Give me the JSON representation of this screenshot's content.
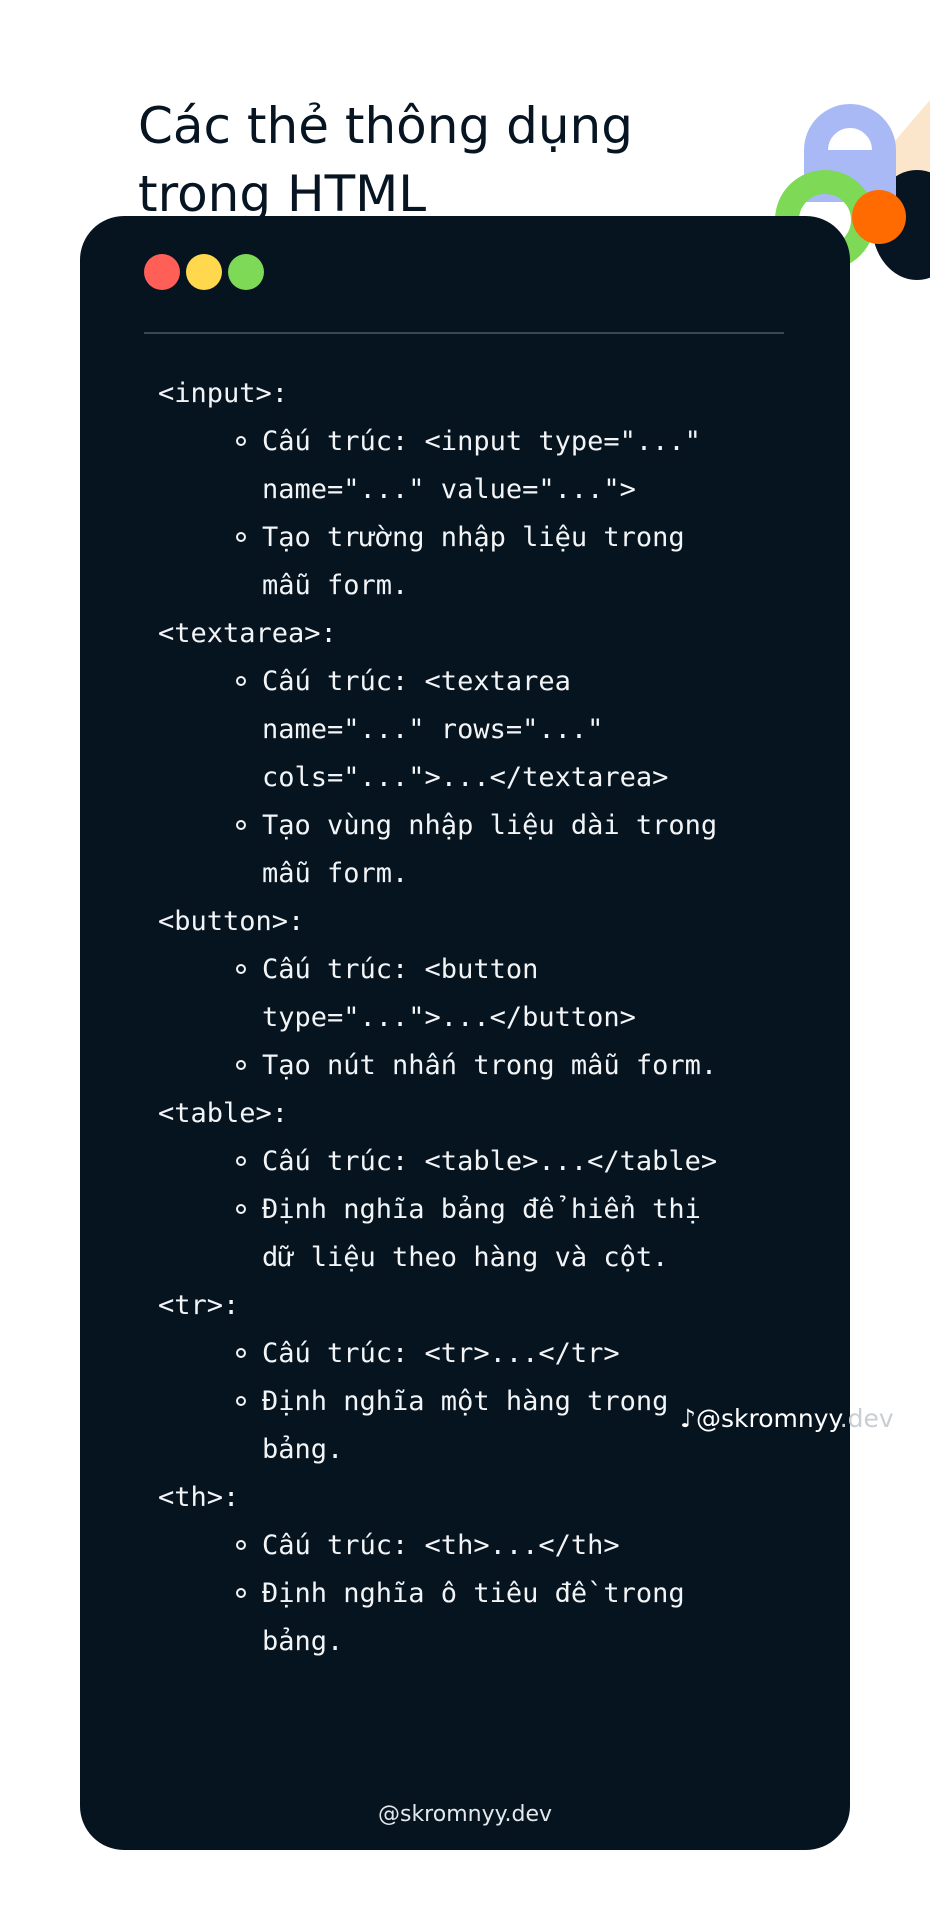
{
  "title": {
    "line1": "Các thẻ thông dụng",
    "line2": "trong HTML"
  },
  "window_dots": {
    "red": "#ff5f57",
    "yellow": "#ffd84d",
    "green": "#7ed957"
  },
  "sections": [
    {
      "tag": "<input>:",
      "bullets": [
        [
          "Cấu trúc: <input type=\"...\"",
          "name=\"...\" value=\"...\">"
        ],
        [
          "Tạo trường nhập liệu trong",
          "mẫu form."
        ]
      ]
    },
    {
      "tag": "<textarea>:",
      "bullets": [
        [
          "Cấu trúc: <textarea",
          "name=\"...\" rows=\"...\"",
          "cols=\"...\">...</textarea>"
        ],
        [
          "Tạo vùng nhập liệu dài trong",
          "mẫu form."
        ]
      ]
    },
    {
      "tag": "<button>:",
      "bullets": [
        [
          "Cấu trúc: <button",
          "type=\"...\">...</button>"
        ],
        [
          "Tạo nút nhấn trong mẫu form."
        ]
      ]
    },
    {
      "tag": "<table>:",
      "bullets": [
        [
          "Cấu trúc: <table>...</table>"
        ],
        [
          "Định nghĩa bảng để hiển thị",
          "dữ liệu theo hàng và cột."
        ]
      ]
    },
    {
      "tag": "<tr>:",
      "bullets": [
        [
          "Cấu trúc: <tr>...</tr>"
        ],
        [
          "Định nghĩa một hàng trong",
          "bảng."
        ]
      ]
    },
    {
      "tag": "<th>:",
      "bullets": [
        [
          "Cấu trúc: <th>...</th>"
        ],
        [
          "Định nghĩa ô tiêu đề trong",
          "bảng."
        ]
      ]
    }
  ],
  "watermark": {
    "icon": "tiktok-icon",
    "text_main": "@skromnyy",
    "text_fade": ".dev"
  },
  "footer": "@skromnyy.dev"
}
